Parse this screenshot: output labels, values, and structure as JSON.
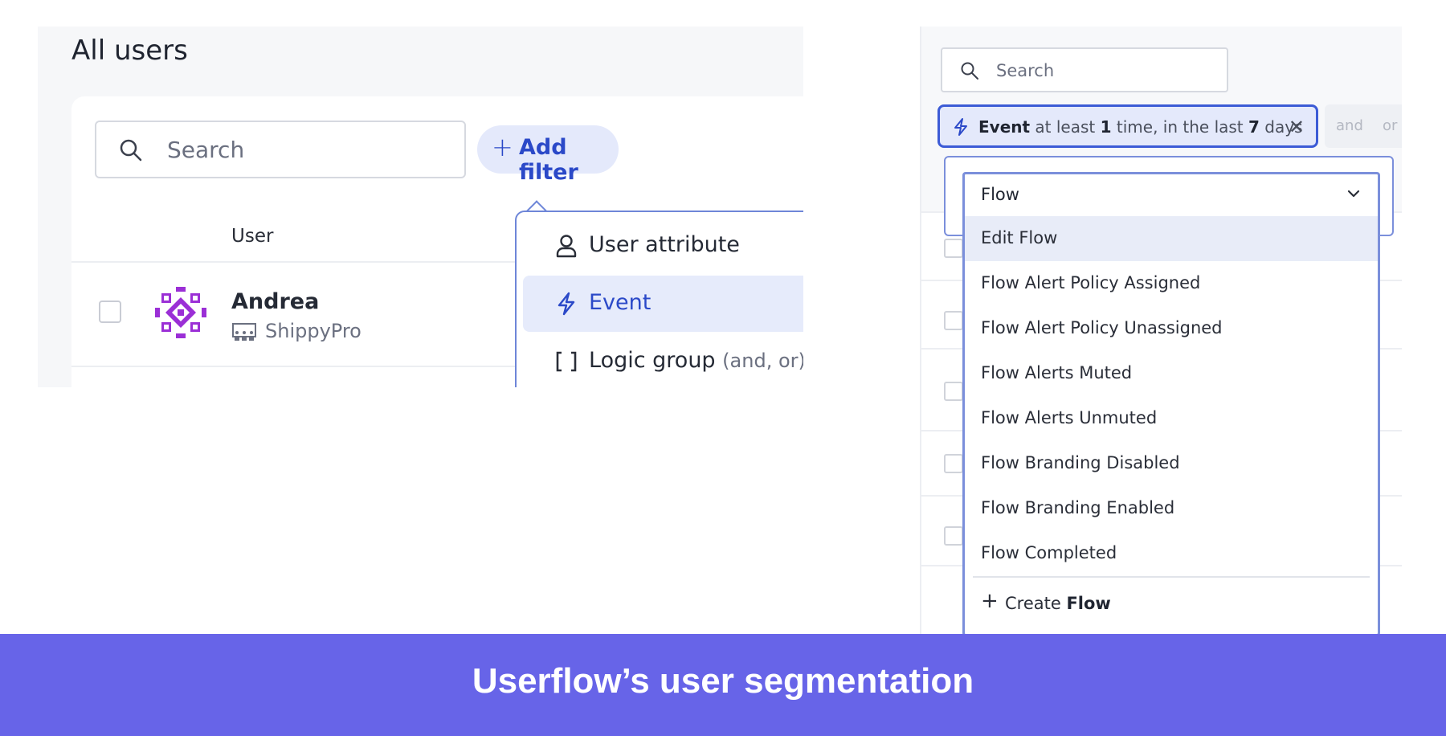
{
  "left": {
    "title": "All users",
    "search_placeholder": "Search",
    "add_filter_label": "Add filter",
    "user_column_header": "User",
    "user_row": {
      "name": "Andrea",
      "company": "ShippyPro"
    },
    "cut_text": "as",
    "menu": [
      {
        "label": "User attribute",
        "hint": "",
        "icon": "person-icon"
      },
      {
        "label": "Event",
        "hint": "",
        "icon": "bolt-icon"
      },
      {
        "label": "Logic group",
        "hint": "(and, or)",
        "icon": "brackets-icon"
      }
    ]
  },
  "right": {
    "search_placeholder": "Search",
    "chip": {
      "type": "Event",
      "text_a": " at least ",
      "count": "1",
      "text_b": " time, in the last ",
      "days": "7",
      "text_c": " days"
    },
    "and_label": "and",
    "or_label": "or",
    "select_value": "Flow",
    "options": [
      "Edit Flow",
      "Flow Alert Policy Assigned",
      "Flow Alert Policy Unassigned",
      "Flow Alerts Muted",
      "Flow Alerts Unmuted",
      "Flow Branding Disabled",
      "Flow Branding Enabled",
      "Flow Completed"
    ],
    "create_prefix": "Create ",
    "create_value": "Flow"
  },
  "footer": {
    "caption": "Userflow’s user segmentation"
  },
  "colors": {
    "accent": "#2b49c8",
    "banner": "#6764e8",
    "avatar": "#9b2fd6",
    "highlight": "#e6ebfb"
  }
}
